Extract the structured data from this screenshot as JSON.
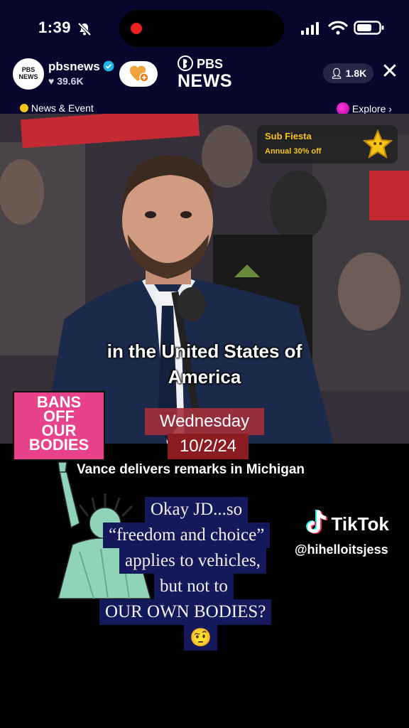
{
  "status_bar": {
    "time": "1:39"
  },
  "header": {
    "avatar_text": "PBS NEWS",
    "account_name": "pbsnews",
    "likes": "39.6K",
    "logo_line1": "PBS",
    "logo_line2": "NEWS",
    "viewer_count": "1.8K",
    "category": "News & Event",
    "explore": "Explore"
  },
  "promo": {
    "title": "Sub Fiesta",
    "subtitle": "Annual 30% off"
  },
  "video": {
    "caption_line1": "in the United States of",
    "caption_line2": "America",
    "sign_text": [
      "BANS",
      "OFF",
      "OUR",
      "BODIES"
    ],
    "date_day": "Wednesday",
    "date": "10/2/24",
    "headline": "Vance delivers remarks in Michigan"
  },
  "overlay": {
    "lines": [
      "Okay JD...so",
      "“freedom and choice”",
      "applies to vehicles,",
      "but not to",
      "OUR OWN BODIES?",
      "🤨"
    ],
    "watermark": "TikTok",
    "handle": "@hihelloitsjess"
  },
  "colors": {
    "header_bg": "#07072e",
    "overlay_bg": "#13195a",
    "date_bg": "#a3303b",
    "sign_bg": "#e8428a"
  }
}
